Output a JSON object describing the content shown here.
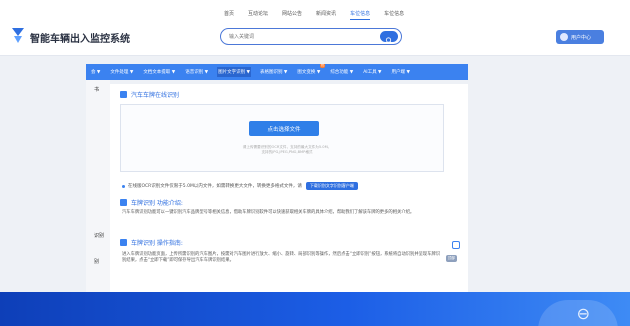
{
  "header": {
    "site_title": "智能车辆出入监控系统",
    "nav": [
      "首页",
      "互动论坛",
      "网站公告",
      "新闻资讯",
      "车位信息",
      "车位信息"
    ],
    "active_nav_index": 4,
    "search_placeholder": "输入关键词",
    "user_label": "用户中心"
  },
  "blue_nav": {
    "items": [
      {
        "label": "会 ▼"
      },
      {
        "label": "文件处理 ▼"
      },
      {
        "label": "文档文本提取 ▼"
      },
      {
        "label": "语音识别 ▼"
      },
      {
        "label": "图片文字识别 ▼"
      },
      {
        "label": "表格图识别 ▼"
      },
      {
        "label": "图文变换 ▼",
        "badge": "热"
      },
      {
        "label": "综合功能 ▼"
      },
      {
        "label": "AI工具 ▼"
      },
      {
        "label": "用户端 ▼"
      }
    ],
    "active_index": 4
  },
  "left_strip": {
    "item1": "书",
    "item2": "识别",
    "item3": "别"
  },
  "main": {
    "online_title": "汽车车牌在线识别",
    "upload_button": "点击选择文件",
    "upload_hint_1": "请上传需要识别的OCR文件，支持的最大文件为5.0M。",
    "upload_hint_2": "支持的JPG,JPEG,PNG,BMP格式",
    "note_text": "在线版OCR识别文件仅限于5.0M以内文件，如需转换更大文件，转换更多格式文件，请",
    "note_link": "下载识别文字识别客户端",
    "intro_title": "车牌识别 功能介绍:",
    "intro_text": "汽车车牌识别功能可以一键识别汽车品牌型号等相关信息，借助车牌识别软件可以快速获取相关车牌的具体介绍，帮助我们了解该车牌的更多的相关介绍。",
    "ops_title": "车牌识别 操作指南:",
    "ops_text": "进入车牌识别功能页面，上传所需识别的汽车图片，按需对汽车图片进行放大、缩小、旋转、局部识别等操作，然后点击“立即识别”按钮，系统将自动识别并呈现车牌识别结果，点击“立即下载”即可保存导出汽车车牌识别结果。",
    "side_label": "顶部"
  },
  "colors": {
    "accent": "#2f6fe0",
    "nav_blue": "#3b82f0",
    "footer_dark": "#0e3fb8"
  }
}
